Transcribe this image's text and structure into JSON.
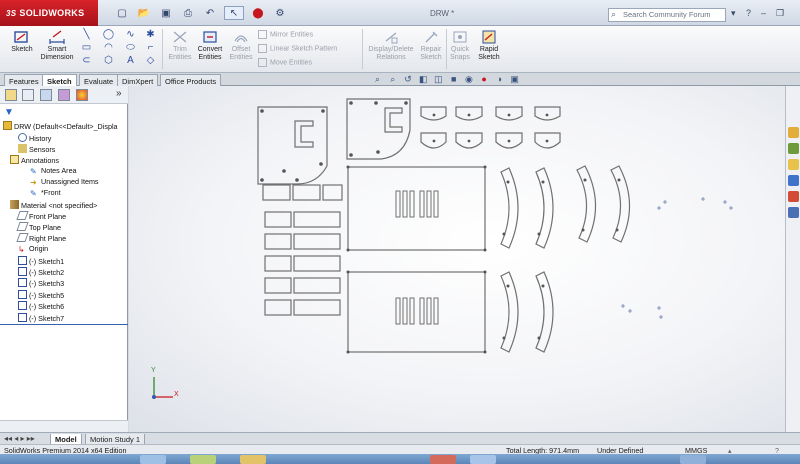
{
  "titlebar": {
    "logo": "SOLIDWORKS",
    "logo_mark": "3S",
    "document_title": "DRW *",
    "search_placeholder": "Search Community Forum",
    "quick_access_icons": [
      "new-icon",
      "open-icon",
      "save-icon",
      "print-icon",
      "undo-icon",
      "select-icon",
      "rebuild-icon",
      "options-icon"
    ]
  },
  "ribbon": {
    "sketch_label": "Sketch",
    "smart_dimension_label": "Smart Dimension",
    "trim_label": "Trim Entities",
    "convert_label": "Convert Entities",
    "offset_label": "Offset Entities",
    "mirror_label": "Mirror Entities",
    "linear_pattern_label": "Linear Sketch Pattern",
    "move_label": "Move Entities",
    "display_delete_label": "Display/Delete Relations",
    "repair_label": "Repair Sketch",
    "quick_snaps_label": "Quick Snaps",
    "rapid_sketch_label": "Rapid Sketch"
  },
  "tabs": [
    "Features",
    "Sketch",
    "Evaluate",
    "DimXpert",
    "Office Products"
  ],
  "active_tab": "Sketch",
  "tree": {
    "root": "DRW (Default<<Default>_Displa",
    "items": [
      {
        "label": "History",
        "icon": "history-icon"
      },
      {
        "label": "Sensors",
        "icon": "sensors-icon"
      },
      {
        "label": "Annotations",
        "icon": "annotations-icon"
      },
      {
        "label": "Notes Area",
        "icon": "notes-area-icon"
      },
      {
        "label": "Unassigned Items",
        "icon": "unassigned-items-icon"
      },
      {
        "label": "*Front",
        "icon": "front-annotation-icon"
      },
      {
        "label": "Material <not specified>",
        "icon": "material-icon"
      },
      {
        "label": "Front Plane",
        "icon": "plane-icon"
      },
      {
        "label": "Top Plane",
        "icon": "plane-icon"
      },
      {
        "label": "Right Plane",
        "icon": "plane-icon"
      },
      {
        "label": "Origin",
        "icon": "origin-icon"
      },
      {
        "label": "(-) Sketch1",
        "icon": "sketch-icon"
      },
      {
        "label": "(-) Sketch2",
        "icon": "sketch-icon"
      },
      {
        "label": "(-) Sketch3",
        "icon": "sketch-icon"
      },
      {
        "label": "(-) Sketch5",
        "icon": "sketch-icon"
      },
      {
        "label": "(-) Sketch6",
        "icon": "sketch-icon"
      },
      {
        "label": "(-) Sketch7",
        "icon": "sketch-icon"
      }
    ]
  },
  "bottom_tabs": [
    "Model",
    "Motion Study 1"
  ],
  "status": {
    "edition": "SolidWorks Premium 2014 x64 Edition",
    "total_length": "Total Length: 971.4mm",
    "state": "Under Defined",
    "units": "MMGS"
  },
  "colors": {
    "brand": "#c8161e",
    "accent": "#355fb0"
  }
}
